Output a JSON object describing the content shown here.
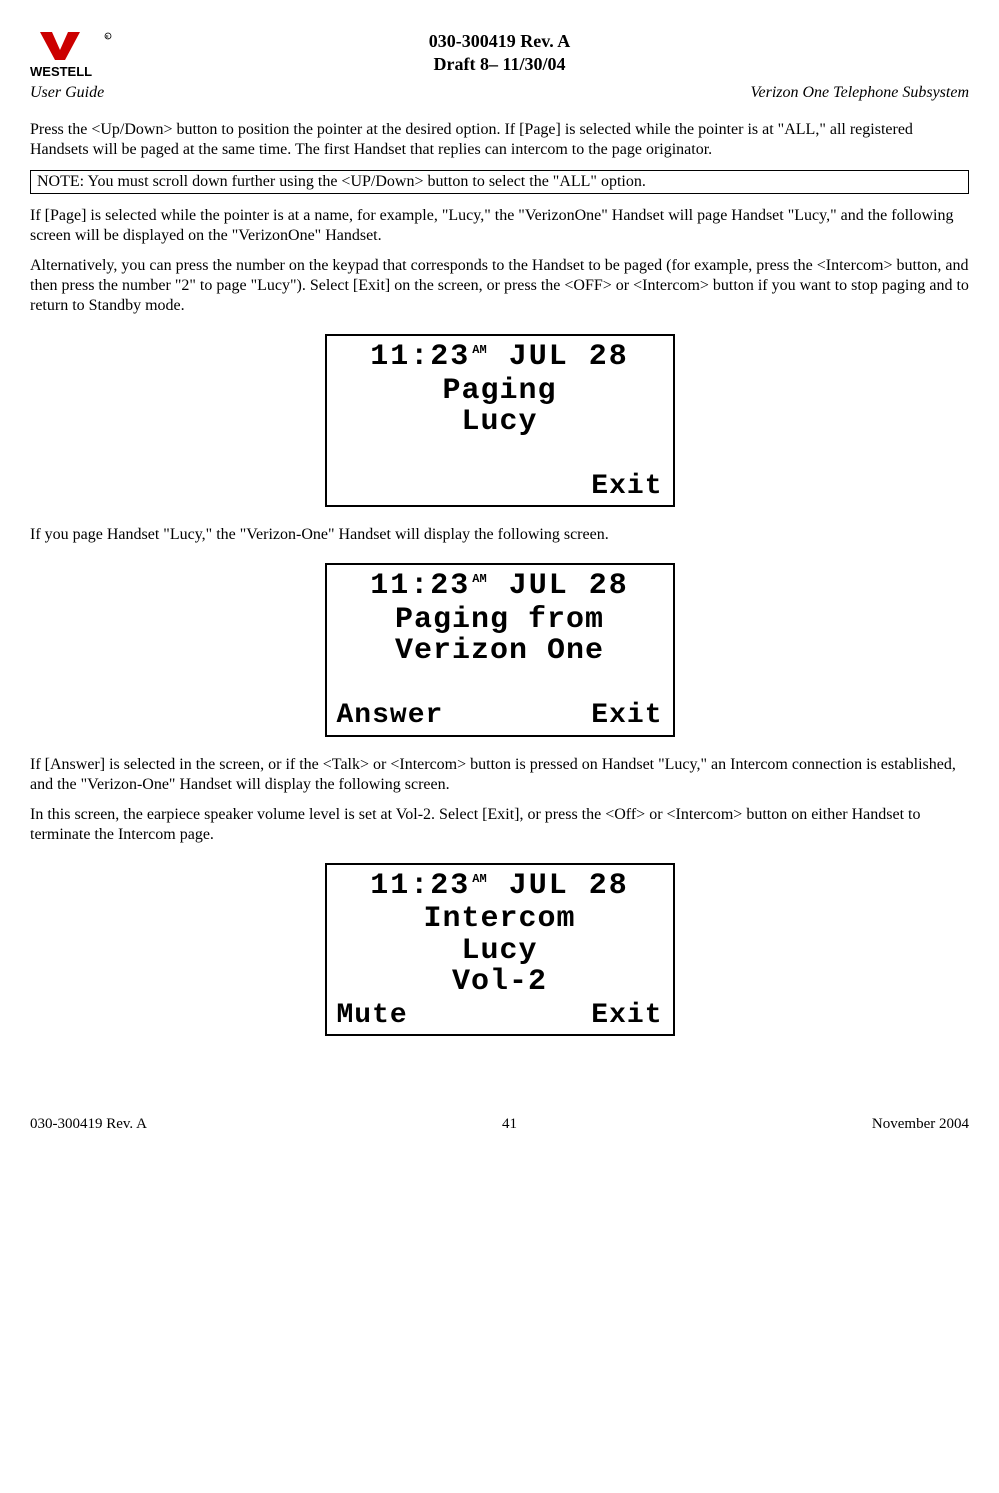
{
  "header": {
    "logo_text": "WESTELL",
    "doc_id": "030-300419 Rev. A",
    "draft": "Draft 8– 11/30/04",
    "left_sub": "User Guide",
    "right_sub": "Verizon One Telephone Subsystem"
  },
  "paragraphs": {
    "p1": "Press the <Up/Down> button to position the pointer at the desired option. If [Page] is selected while the pointer is at \"ALL,\" all registered Handsets will be paged at the same time. The first Handset that replies can intercom to the page originator.",
    "note": "NOTE:  You must scroll down further using the <UP/Down> button to select the \"ALL\" option.",
    "p2": "If [Page] is selected while the pointer is at a name, for example, \"Lucy,\" the \"VerizonOne\" Handset will page Handset \"Lucy,\" and the following screen will be displayed on the \"VerizonOne\" Handset.",
    "p3": "Alternatively, you can press the number on the keypad that corresponds to the Handset to be paged (for example, press the <Intercom> button, and then press the number \"2\" to page \"Lucy\"). Select [Exit] on the screen, or press the <OFF> or <Intercom> button if you want to stop paging and to return to Standby mode.",
    "p4": "If you page Handset \"Lucy,\" the \"Verizon-One\" Handset will display the following screen.",
    "p5": "If [Answer] is selected in the screen, or if the <Talk> or <Intercom> button is pressed on Handset \"Lucy,\" an Intercom connection is established, and the \"Verizon-One\" Handset will display the following screen.",
    "p6": "In this screen, the earpiece speaker volume level is set at Vol-2. Select [Exit], or press the <Off> or <Intercom> button on either Handset to terminate the Intercom page."
  },
  "lcd_common": {
    "time": "11:23",
    "ampm": "AM",
    "date": "JUL 28"
  },
  "lcd1": {
    "line1": "Paging",
    "line2": "Lucy",
    "line3": "",
    "bottom_left": "",
    "bottom_right": "Exit"
  },
  "lcd2": {
    "line1": "Paging from",
    "line2": "Verizon One",
    "line3": "",
    "bottom_left": "Answer",
    "bottom_right": "Exit"
  },
  "lcd3": {
    "line1": "Intercom",
    "line2": "Lucy",
    "line3": "Vol-2",
    "bottom_left": "Mute",
    "bottom_right": "Exit"
  },
  "footer": {
    "left": "030-300419 Rev. A",
    "center": "41",
    "right": "November 2004"
  }
}
